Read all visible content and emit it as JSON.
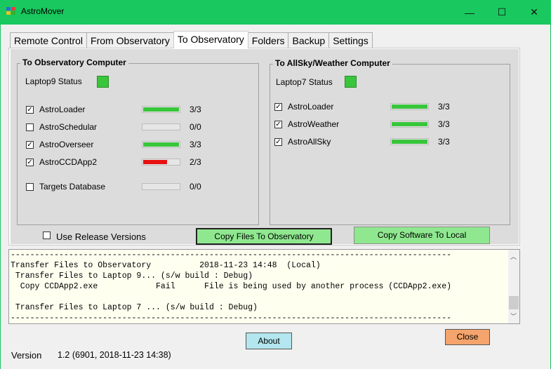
{
  "window": {
    "title": "AstroMover",
    "minimize": "—",
    "maximize": "☐",
    "close": "✕"
  },
  "tabs": [
    {
      "label": "Remote Control"
    },
    {
      "label": "From Observatory"
    },
    {
      "label": "To Observatory"
    },
    {
      "label": "Folders"
    },
    {
      "label": "Backup"
    },
    {
      "label": "Settings"
    }
  ],
  "observatory": {
    "title": "To Observatory Computer",
    "status_label": "Laptop9 Status",
    "status_color": "#39c53c",
    "items": [
      {
        "label": "AstroLoader",
        "checked": true,
        "count": "3/3",
        "progress": 1.0,
        "color": "#39c53c"
      },
      {
        "label": "AstroSchedular",
        "checked": false,
        "count": "0/0",
        "progress": 0.0,
        "color": "#39c53c"
      },
      {
        "label": "AstroOverseer",
        "checked": true,
        "count": "3/3",
        "progress": 1.0,
        "color": "#39c53c"
      },
      {
        "label": "AstroCCDApp2",
        "checked": true,
        "count": "2/3",
        "progress": 0.67,
        "color": "#e81010"
      },
      {
        "label": "Targets Database",
        "checked": false,
        "count": "0/0",
        "progress": 0.0,
        "color": "#39c53c"
      }
    ]
  },
  "allsky": {
    "title": "To AllSky/Weather Computer",
    "status_label": "Laptop7 Status",
    "status_color": "#39c53c",
    "items": [
      {
        "label": "AstroLoader",
        "checked": true,
        "count": "3/3",
        "progress": 1.0,
        "color": "#39c53c"
      },
      {
        "label": "AstroWeather",
        "checked": true,
        "count": "3/3",
        "progress": 1.0,
        "color": "#39c53c"
      },
      {
        "label": "AstroAllSky",
        "checked": true,
        "count": "3/3",
        "progress": 1.0,
        "color": "#39c53c"
      }
    ]
  },
  "use_release": {
    "label": "Use Release Versions",
    "checked": false
  },
  "buttons": {
    "copy_to_observatory": "Copy Files To Observatory",
    "copy_to_local": "Copy Software To Local",
    "about": "About",
    "close": "Close"
  },
  "log_lines": [
    "-------------------------------------------------------------------------------------------",
    "Transfer Files to Observatory          2018-11-23 14:48  (Local)",
    " Transfer Files to Laptop 9... (s/w build : Debug)",
    "  Copy CCDApp2.exe            Fail      File is being used by another process (CCDApp2.exe)",
    "",
    " Transfer Files to Laptop 7 ... (s/w build : Debug)",
    "-------------------------------------------------------------------------------------------"
  ],
  "version": {
    "label": "Version",
    "value": "1.2  (6901,  2018-11-23 14:38)"
  },
  "colors": {
    "titlebar": "#19c85e",
    "green_button": "#8fe88f",
    "about_button": "#b3e6ee",
    "close_button": "#f4a46c"
  }
}
